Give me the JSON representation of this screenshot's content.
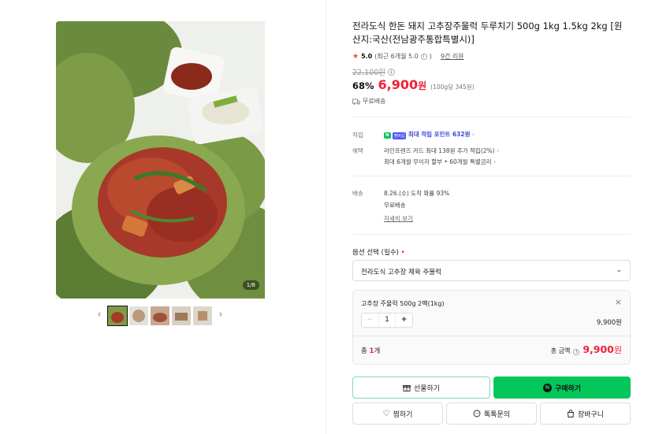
{
  "gallery": {
    "counter": "1/8",
    "prev_icon": "chevron-left-icon",
    "next_icon": "chevron-right-icon",
    "thumbnail_count": 5
  },
  "product": {
    "title": "전라도식 한돈 돼지 고추장주물럭 두루치기 500g 1kg 1.5kg 2kg [원산지:국산(전남광주통합특별시)]",
    "rating_score": "5.0",
    "rating_detail": "(최근 6개월 5.0",
    "rating_close": ")",
    "review_count": "9건 리뷰",
    "original_price": "22,100원",
    "discount": "68%",
    "price": "6,900",
    "price_unit": "원",
    "unit_price": "(100g당 345원)",
    "shipping_label": "무료배송"
  },
  "benefits": {
    "point_label": "적립",
    "point_badge_n": "N",
    "point_badge_m": "멤버십",
    "point_text": "최대 적립 포인트 632원",
    "benefit_label": "혜택",
    "benefit_line1": "라인프렌즈 카드 최대 138원 추가 적립(2%)",
    "benefit_line2": "최대 6개월 무이자 할부 • 60개월 특별금리"
  },
  "delivery": {
    "label": "배송",
    "line1": "8.26.(수) 도착 확률 93%",
    "line2": "무료배송",
    "detail_link": "자세히 보기"
  },
  "options": {
    "label": "옵션 선택 (필수)",
    "required_mark": "•",
    "selected_value": "전라도식 고추장 제육 주물럭",
    "item_name": "고추장 주물럭 500g 2팩(1kg)",
    "quantity": "1",
    "minus": "−",
    "plus": "+",
    "item_price": "9,900원",
    "total_count_prefix": "총 ",
    "total_count_num": "1",
    "total_count_suffix": "개",
    "total_amount_label": "총 금액",
    "total_price": "9,900",
    "total_unit": "원"
  },
  "actions": {
    "gift": "선물하기",
    "buy": "구매하기",
    "buy_badge": "N",
    "like": "찜하기",
    "talk": "톡톡문의",
    "cart": "장바구니"
  },
  "colors": {
    "accent_red": "#f0203a",
    "naver_green": "#03c75a",
    "point_blue": "#3b4ad8"
  }
}
